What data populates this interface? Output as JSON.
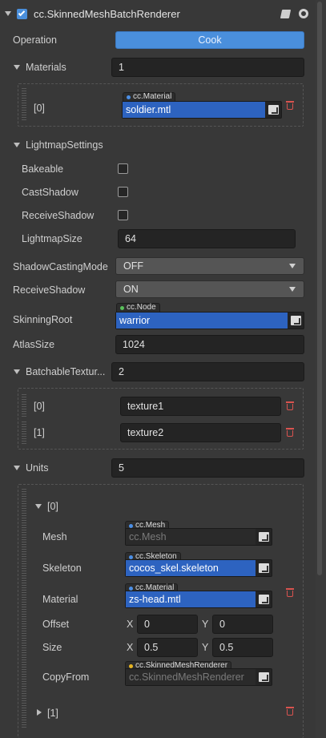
{
  "header": {
    "component_name": "cc.SkinnedMeshBatchRenderer",
    "enabled": true
  },
  "operation": {
    "label": "Operation",
    "button_label": "Cook"
  },
  "materials": {
    "label": "Materials",
    "count": "1",
    "items": [
      {
        "index": "[0]",
        "type_tag": "cc.Material",
        "value": "soldier.mtl"
      }
    ]
  },
  "lightmap_settings": {
    "label": "LightmapSettings",
    "bakeable": {
      "label": "Bakeable",
      "checked": false
    },
    "cast_shadow": {
      "label": "CastShadow",
      "checked": false
    },
    "receive_shadow": {
      "label": "ReceiveShadow",
      "checked": false
    },
    "lightmap_size": {
      "label": "LightmapSize",
      "value": "64"
    }
  },
  "shadow_casting_mode": {
    "label": "ShadowCastingMode",
    "value": "OFF"
  },
  "receive_shadow": {
    "label": "ReceiveShadow",
    "value": "ON"
  },
  "skinning_root": {
    "label": "SkinningRoot",
    "type_tag": "cc.Node",
    "value": "warrior"
  },
  "atlas_size": {
    "label": "AtlasSize",
    "value": "1024"
  },
  "batchable_textures": {
    "label": "BatchableTextur...",
    "count": "2",
    "items": [
      {
        "index": "[0]",
        "value": "texture1"
      },
      {
        "index": "[1]",
        "value": "texture2"
      }
    ]
  },
  "units": {
    "label": "Units",
    "count": "5",
    "unit0": {
      "index": "[0]",
      "mesh": {
        "label": "Mesh",
        "type_tag": "cc.Mesh",
        "value": "cc.Mesh"
      },
      "skeleton": {
        "label": "Skeleton",
        "type_tag": "cc.Skeleton",
        "value": "cocos_skel.skeleton"
      },
      "material": {
        "label": "Material",
        "type_tag": "cc.Material",
        "value": "zs-head.mtl"
      },
      "offset": {
        "label": "Offset",
        "x_label": "X",
        "x": "0",
        "y_label": "Y",
        "y": "0"
      },
      "size": {
        "label": "Size",
        "x_label": "X",
        "x": "0.5",
        "y_label": "Y",
        "y": "0.5"
      },
      "copy_from": {
        "label": "CopyFrom",
        "type_tag": "cc.SkinnedMeshRenderer",
        "value": "cc.SkinnedMeshRenderer"
      }
    },
    "unit1": {
      "index": "[1]"
    }
  },
  "colors": {
    "accent_blue": "#2d63c0",
    "cook_button": "#4a8fdc",
    "trash_red": "#d9534f",
    "tag_dot_blue": "#4b8fe6",
    "tag_dot_green": "#59c15a",
    "tag_dot_yellow": "#e6b422"
  },
  "icons": [
    "chevron-down-icon",
    "checkbox-icon",
    "book-icon",
    "gear-icon",
    "trash-icon",
    "asset-picker-icon",
    "chevron-right-icon"
  ]
}
